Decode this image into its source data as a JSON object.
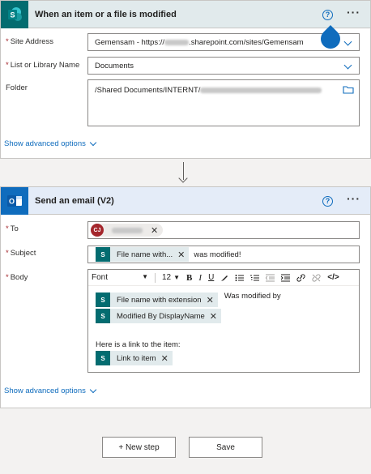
{
  "trigger": {
    "title": "When an item or a file is modified",
    "icon": "sharepoint-icon",
    "site_address_label": "Site Address",
    "site_address_value_prefix": "Gemensam - https://",
    "site_address_value_suffix": ".sharepoint.com/sites/Gemensam",
    "list_label": "List or Library Name",
    "list_value": "Documents",
    "folder_label": "Folder",
    "folder_value": "/Shared Documents/INTERNT/",
    "advanced_label": "Show advanced options"
  },
  "email": {
    "title": "Send an email (V2)",
    "icon": "outlook-icon",
    "to_label": "To",
    "to_initials": "CJ",
    "subject_label": "Subject",
    "subject_token": "File name with...",
    "subject_text": "was modified!",
    "body_label": "Body",
    "font_select": "Font",
    "font_size": "12",
    "body_token1": "File name with extension",
    "body_text1": "Was modified by",
    "body_token2": "Modified By DisplayName",
    "body_text2": "Here is a link to the item:",
    "body_token3": "Link to item",
    "advanced_label": "Show advanced options"
  },
  "actions": {
    "new_step": "+ New step",
    "save": "Save"
  },
  "colors": {
    "sharepoint": "#036c70",
    "outlook": "#0f6cbd",
    "link": "#0f6cbd",
    "required": "#a4262c"
  }
}
